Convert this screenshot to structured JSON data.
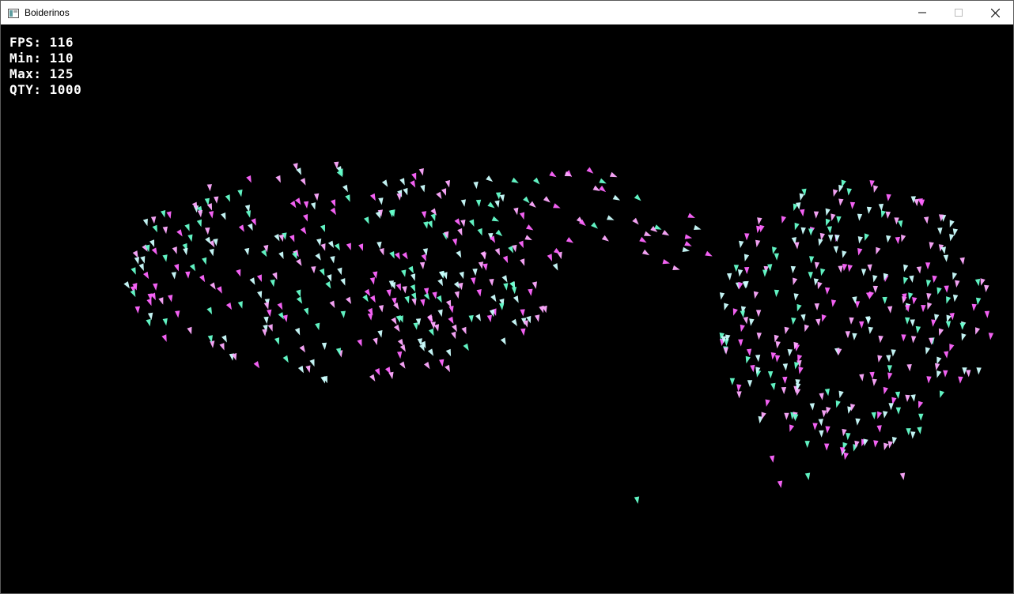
{
  "window": {
    "title": "Boiderinos",
    "icon": "app-window-icon",
    "controls": {
      "minimize_icon": "minimize-icon",
      "maximize_icon": "maximize-icon",
      "close_icon": "close-icon"
    }
  },
  "hud": {
    "fps": "FPS: 116",
    "min": "Min: 110",
    "max": "Max: 125",
    "qty": "QTY: 1000"
  },
  "scene": {
    "background": "#000000",
    "boid_colors": [
      "#ff66ff",
      "#66ffcc",
      "#ccffff",
      "#ffaaff"
    ]
  }
}
